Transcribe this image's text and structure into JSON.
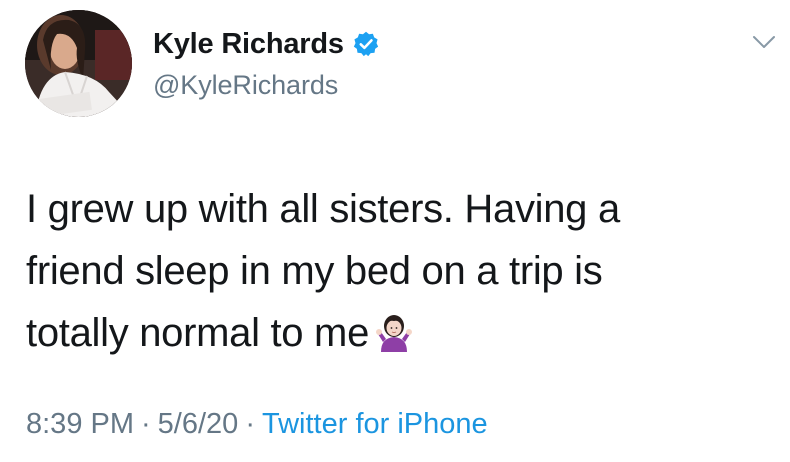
{
  "user": {
    "display_name": "Kyle Richards",
    "handle": "@KyleRichards",
    "verified": true,
    "avatar_icon": "profile-photo"
  },
  "tweet": {
    "lines": [
      "I grew up with all sisters. Having a",
      "friend sleep in my bed on a trip is",
      "totally normal to me"
    ],
    "emoji_icon": "person-shrugging-emoji"
  },
  "meta": {
    "time": "8:39 PM",
    "date": "5/6/20",
    "separator": "·",
    "source": "Twitter for iPhone"
  },
  "colors": {
    "text": "#14171a",
    "secondary": "#657786",
    "link": "#1b95e0",
    "verified": "#1da1f2"
  },
  "icons": {
    "menu": "chevron-down-icon",
    "verified": "verified-badge-icon"
  }
}
